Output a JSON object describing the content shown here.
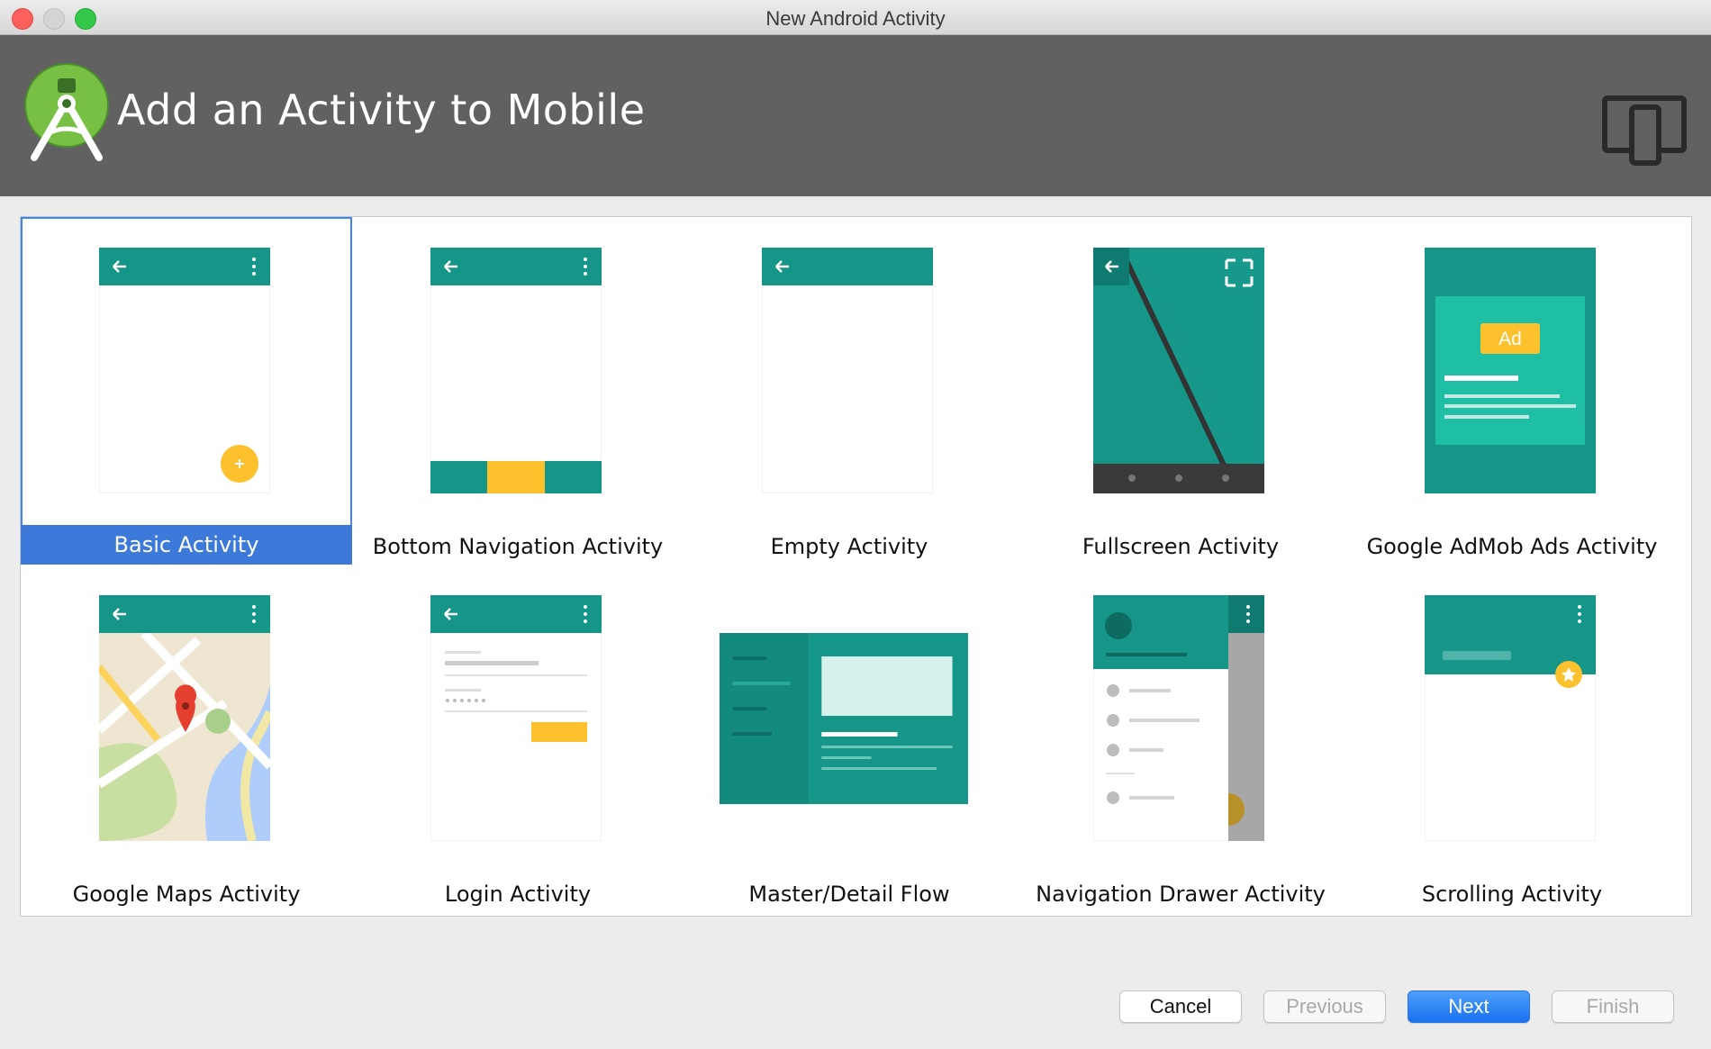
{
  "window": {
    "title": "New Android Activity"
  },
  "header": {
    "title": "Add an Activity to Mobile",
    "logo_icon": "android-studio-logo-icon",
    "device_icon": "device-form-factor-icon"
  },
  "templates": [
    {
      "label": "Basic Activity",
      "selected": true
    },
    {
      "label": "Bottom Navigation Activity"
    },
    {
      "label": "Empty Activity"
    },
    {
      "label": "Fullscreen Activity"
    },
    {
      "label": "Google AdMob Ads Activity",
      "badge": "Ad"
    },
    {
      "label": "Google Maps Activity"
    },
    {
      "label": "Login Activity"
    },
    {
      "label": "Master/Detail Flow"
    },
    {
      "label": "Navigation Drawer Activity"
    },
    {
      "label": "Scrolling Activity"
    }
  ],
  "buttons": {
    "cancel": "Cancel",
    "previous": "Previous",
    "next": "Next",
    "finish": "Finish"
  },
  "colors": {
    "teal": "#159688",
    "amber": "#fdc12d",
    "selection": "#3d79d8",
    "header_bg": "#616161"
  }
}
